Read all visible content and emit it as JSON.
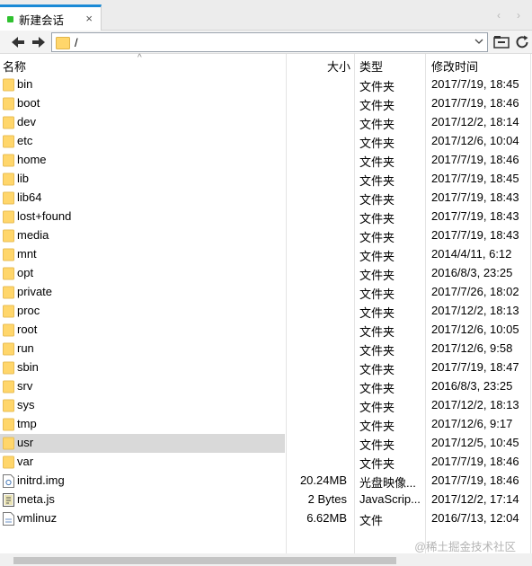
{
  "tabs": [
    {
      "label": "新建会话",
      "close": "×"
    }
  ],
  "tabbar": {
    "nav_left": "‹",
    "nav_right": "›"
  },
  "address": {
    "path": "/"
  },
  "columns": {
    "name": "名称",
    "size": "大小",
    "type": "类型",
    "modified": "修改时间"
  },
  "files": [
    {
      "name": "bin",
      "size": "",
      "type": "文件夹",
      "modified": "2017/7/19, 18:45",
      "icon": "folder-icon"
    },
    {
      "name": "boot",
      "size": "",
      "type": "文件夹",
      "modified": "2017/7/19, 18:46",
      "icon": "folder-icon"
    },
    {
      "name": "dev",
      "size": "",
      "type": "文件夹",
      "modified": "2017/12/2, 18:14",
      "icon": "folder-icon"
    },
    {
      "name": "etc",
      "size": "",
      "type": "文件夹",
      "modified": "2017/12/6, 10:04",
      "icon": "folder-icon"
    },
    {
      "name": "home",
      "size": "",
      "type": "文件夹",
      "modified": "2017/7/19, 18:46",
      "icon": "folder-icon"
    },
    {
      "name": "lib",
      "size": "",
      "type": "文件夹",
      "modified": "2017/7/19, 18:45",
      "icon": "folder-icon"
    },
    {
      "name": "lib64",
      "size": "",
      "type": "文件夹",
      "modified": "2017/7/19, 18:43",
      "icon": "folder-icon"
    },
    {
      "name": "lost+found",
      "size": "",
      "type": "文件夹",
      "modified": "2017/7/19, 18:43",
      "icon": "folder-icon"
    },
    {
      "name": "media",
      "size": "",
      "type": "文件夹",
      "modified": "2017/7/19, 18:43",
      "icon": "folder-icon"
    },
    {
      "name": "mnt",
      "size": "",
      "type": "文件夹",
      "modified": "2014/4/11, 6:12",
      "icon": "folder-icon"
    },
    {
      "name": "opt",
      "size": "",
      "type": "文件夹",
      "modified": "2016/8/3, 23:25",
      "icon": "folder-icon"
    },
    {
      "name": "private",
      "size": "",
      "type": "文件夹",
      "modified": "2017/7/26, 18:02",
      "icon": "folder-icon"
    },
    {
      "name": "proc",
      "size": "",
      "type": "文件夹",
      "modified": "2017/12/2, 18:13",
      "icon": "folder-icon"
    },
    {
      "name": "root",
      "size": "",
      "type": "文件夹",
      "modified": "2017/12/6, 10:05",
      "icon": "folder-icon"
    },
    {
      "name": "run",
      "size": "",
      "type": "文件夹",
      "modified": "2017/12/6, 9:58",
      "icon": "folder-icon"
    },
    {
      "name": "sbin",
      "size": "",
      "type": "文件夹",
      "modified": "2017/7/19, 18:47",
      "icon": "folder-icon"
    },
    {
      "name": "srv",
      "size": "",
      "type": "文件夹",
      "modified": "2016/8/3, 23:25",
      "icon": "folder-icon"
    },
    {
      "name": "sys",
      "size": "",
      "type": "文件夹",
      "modified": "2017/12/2, 18:13",
      "icon": "folder-icon"
    },
    {
      "name": "tmp",
      "size": "",
      "type": "文件夹",
      "modified": "2017/12/6, 9:17",
      "icon": "folder-icon"
    },
    {
      "name": "usr",
      "size": "",
      "type": "文件夹",
      "modified": "2017/12/5, 10:45",
      "icon": "folder-icon",
      "selected": true
    },
    {
      "name": "var",
      "size": "",
      "type": "文件夹",
      "modified": "2017/7/19, 18:46",
      "icon": "folder-icon"
    },
    {
      "name": "initrd.img",
      "size": "20.24MB",
      "type": "光盘映像...",
      "modified": "2017/7/19, 18:46",
      "icon": "disk-image-icon"
    },
    {
      "name": "meta.js",
      "size": "2 Bytes",
      "type": "JavaScrip...",
      "modified": "2017/12/2, 17:14",
      "icon": "script-file-icon"
    },
    {
      "name": "vmlinuz",
      "size": "6.62MB",
      "type": "文件",
      "modified": "2016/7/13, 12:04",
      "icon": "file-icon"
    }
  ],
  "watermark": "@稀土掘金技术社区",
  "colors": {
    "accent": "#1a8ad6",
    "folder": "#ffd66b",
    "selection": "#d9d9d9"
  }
}
